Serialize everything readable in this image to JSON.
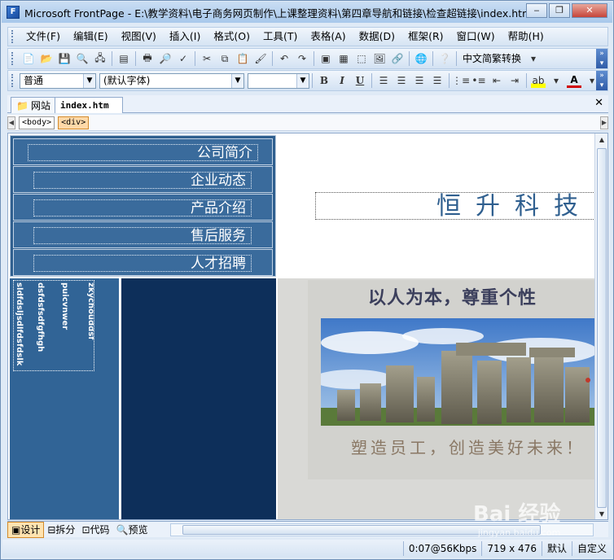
{
  "window": {
    "title": "Microsoft FrontPage - E:\\教学资料\\电子商务网页制作\\上课整理资料\\第四章导航和链接\\检查超链接\\index.htm",
    "app_icon": "F",
    "controls": [
      "minimize-icon",
      "restore-icon",
      "close-icon"
    ]
  },
  "menu": [
    "文件(F)",
    "编辑(E)",
    "视图(V)",
    "插入(I)",
    "格式(O)",
    "工具(T)",
    "表格(A)",
    "数据(D)",
    "框架(R)",
    "窗口(W)",
    "帮助(H)"
  ],
  "toolbar": {
    "convert_label": "中文简繁转换",
    "style_value": "普通",
    "font_value": "(默认字体)",
    "size_value": "",
    "bold": "B",
    "italic": "I",
    "underline": "U"
  },
  "tabs": {
    "site_label": "网站",
    "file_label": "index.htm"
  },
  "breadcrumb": [
    "<body>",
    "<div>"
  ],
  "page": {
    "nav_links": [
      "公司简介",
      "企业动态",
      "产品介绍",
      "售后服务",
      "人才招聘"
    ],
    "brand_title": "恒升科技",
    "vertical_texts": [
      "zkychouddsf",
      "puicvnwer",
      "dsfdsfsdfgfhgh",
      "sldfdsljsdlfdsfdslk"
    ],
    "slogan": "以人为本，尊重个性",
    "motto": "塑造员工，创造美好未来！"
  },
  "views": [
    "设计",
    "拆分",
    "代码",
    "预览"
  ],
  "status": {
    "speed": "0:07@56Kbps",
    "size": "719 x 476",
    "mode": "默认",
    "custom": "自定义"
  },
  "watermark": {
    "brand": "Bai 经验",
    "url": "jingyan.baidu.com"
  },
  "colors": {
    "nav_bg": "#2f5f8f",
    "brand_text": "#2f5f8f",
    "col_a": "#316496",
    "col_b": "#0d2f5a",
    "slogan": "#3b3f5c",
    "motto": "#8a7865"
  }
}
